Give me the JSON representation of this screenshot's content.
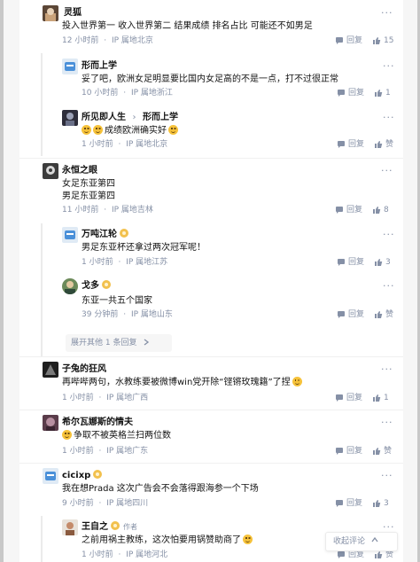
{
  "colors": {
    "link": "#8590a6",
    "text": "#121212",
    "frame": "#c8c8c8"
  },
  "comments": [
    {
      "author": "灵狐",
      "body": "投入世界第一 收入世界第二 结果成绩 排名占比 可能还不如男足",
      "time": "12 小时前",
      "ip": "IP 属地北京",
      "reply": "回复",
      "likes": "15"
    },
    {
      "author": "形而上学",
      "body": "妥了吧，欧洲女足明显要比国内女足高的不是一点，打不过很正常",
      "time": "10 小时前",
      "ip": "IP 属地浙江",
      "reply": "回复",
      "likes": "1"
    },
    {
      "author": "所见即人生",
      "reply_arrow": "›",
      "reply_to": "形而上学",
      "body": "成绩欧洲确实好",
      "time": "1 小时前",
      "ip": "IP 属地北京",
      "reply": "回复",
      "likes": "赞"
    },
    {
      "author": "永恒之眼",
      "body_line1": "女足东亚第四",
      "body_line2": "男足东亚第四",
      "time": "11 小时前",
      "ip": "IP 属地吉林",
      "reply": "回复",
      "likes": "8"
    },
    {
      "author": "万吨江轮",
      "body": "男足东亚杯还拿过两次冠军呢！",
      "time": "1 小时前",
      "ip": "IP 属地江苏",
      "reply": "回复",
      "likes": "3"
    },
    {
      "author": "戈多",
      "body": "东亚一共五个国家",
      "time": "39 分钟前",
      "ip": "IP 属地山东",
      "reply": "回复",
      "likes": "赞"
    },
    {
      "author": "子兔的狂风",
      "body": "再哔哔两句，水教练要被微博win党开除“铿锵玫瑰籍”了捏",
      "time": "1 小时前",
      "ip": "IP 属地广西",
      "reply": "回复",
      "likes": "1"
    },
    {
      "author": "希尔瓦娜斯的情夫",
      "body": "争取不被英格兰扫两位数",
      "time": "1 小时前",
      "ip": "IP 属地广东",
      "reply": "回复",
      "likes": "赞"
    },
    {
      "author": "cicixp",
      "body": "我在想Prada 这次广告会不会落得跟海参一个下场",
      "time": "9 小时前",
      "ip": "IP 属地四川",
      "reply": "回复",
      "likes": "3"
    },
    {
      "author": "王自之",
      "author_tag": "作者",
      "body": "之前用祸主教练，这次怕要用锅赞助商了",
      "time": "1 小时前",
      "ip": "IP 属地河北",
      "reply": "回复",
      "likes": "赞"
    }
  ],
  "expand_replies": "展开其他 1 条回复",
  "collapse_comments": "收起评论",
  "meta_separator": "·",
  "more_label": "···",
  "icons": {
    "more": "more-dots-icon",
    "reply": "reply-bubble-icon",
    "like": "thumbs-up-icon",
    "chevron": "chevron-right-icon",
    "collapse": "chevron-up-icon"
  }
}
